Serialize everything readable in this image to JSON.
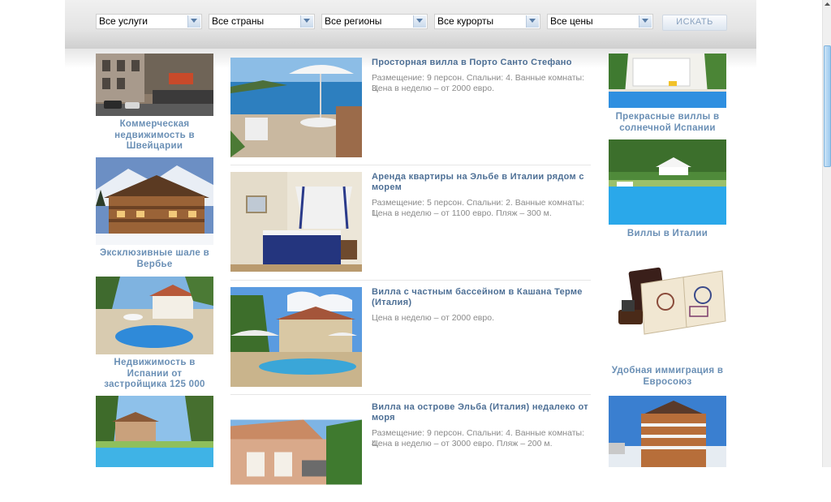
{
  "filters": {
    "services": "Все услуги",
    "countries": "Все страны",
    "regions": "Все регионы",
    "resorts": "Все курорты",
    "prices": "Все цены",
    "search_label": "ИСКАТЬ"
  },
  "left_column": [
    {
      "caption": "Коммерческая недвижимость в Швейцарии"
    },
    {
      "caption": "Эксклюзивные шале в Вербье"
    },
    {
      "caption": "Недвижимость в Испании от застройщика 125 000"
    },
    {
      "caption": ""
    }
  ],
  "listings": [
    {
      "title": "Просторная вилла в Порто Санто Стефано",
      "desc_1": "Размещение: 9 персон. Спальни: 4. Ванные комнаты: 3.",
      "desc_2": "Цена в неделю – от 2000 евро."
    },
    {
      "title": "Аренда квартиры на Эльбе в Италии рядом с морем",
      "desc_1": "Размещение: 5 персон. Спальни: 2. Ванные комнаты: 1.",
      "desc_2": "Цена в неделю – от 1100 евро. Пляж – 300 м."
    },
    {
      "title": "Вилла с частным бассейном в Кашана Терме (Италия)",
      "desc_1": "Цена в неделю – от 2000 евро.",
      "desc_2": ""
    },
    {
      "title": "Вилла на острове Эльба (Италия) недалеко от моря",
      "desc_1": "Размещение: 9 персон. Спальни: 4. Ванные комнаты: 4.",
      "desc_2": "Цена в неделю – от 3000 евро. Пляж – 200 м."
    }
  ],
  "right_column": [
    {
      "caption": "Прекрасные виллы в солнечной Испании"
    },
    {
      "caption": "Виллы в Италии"
    },
    {
      "caption": "Удобная иммиграция в Евросоюз"
    },
    {
      "caption": ""
    }
  ],
  "icons": {
    "dropdown": "chevron-down-icon",
    "scroll_up": "scroll-up-arrow-icon"
  },
  "colors": {
    "link": "#4d6f95",
    "caption": "#6a8fb5",
    "description": "#8a8a8a"
  }
}
